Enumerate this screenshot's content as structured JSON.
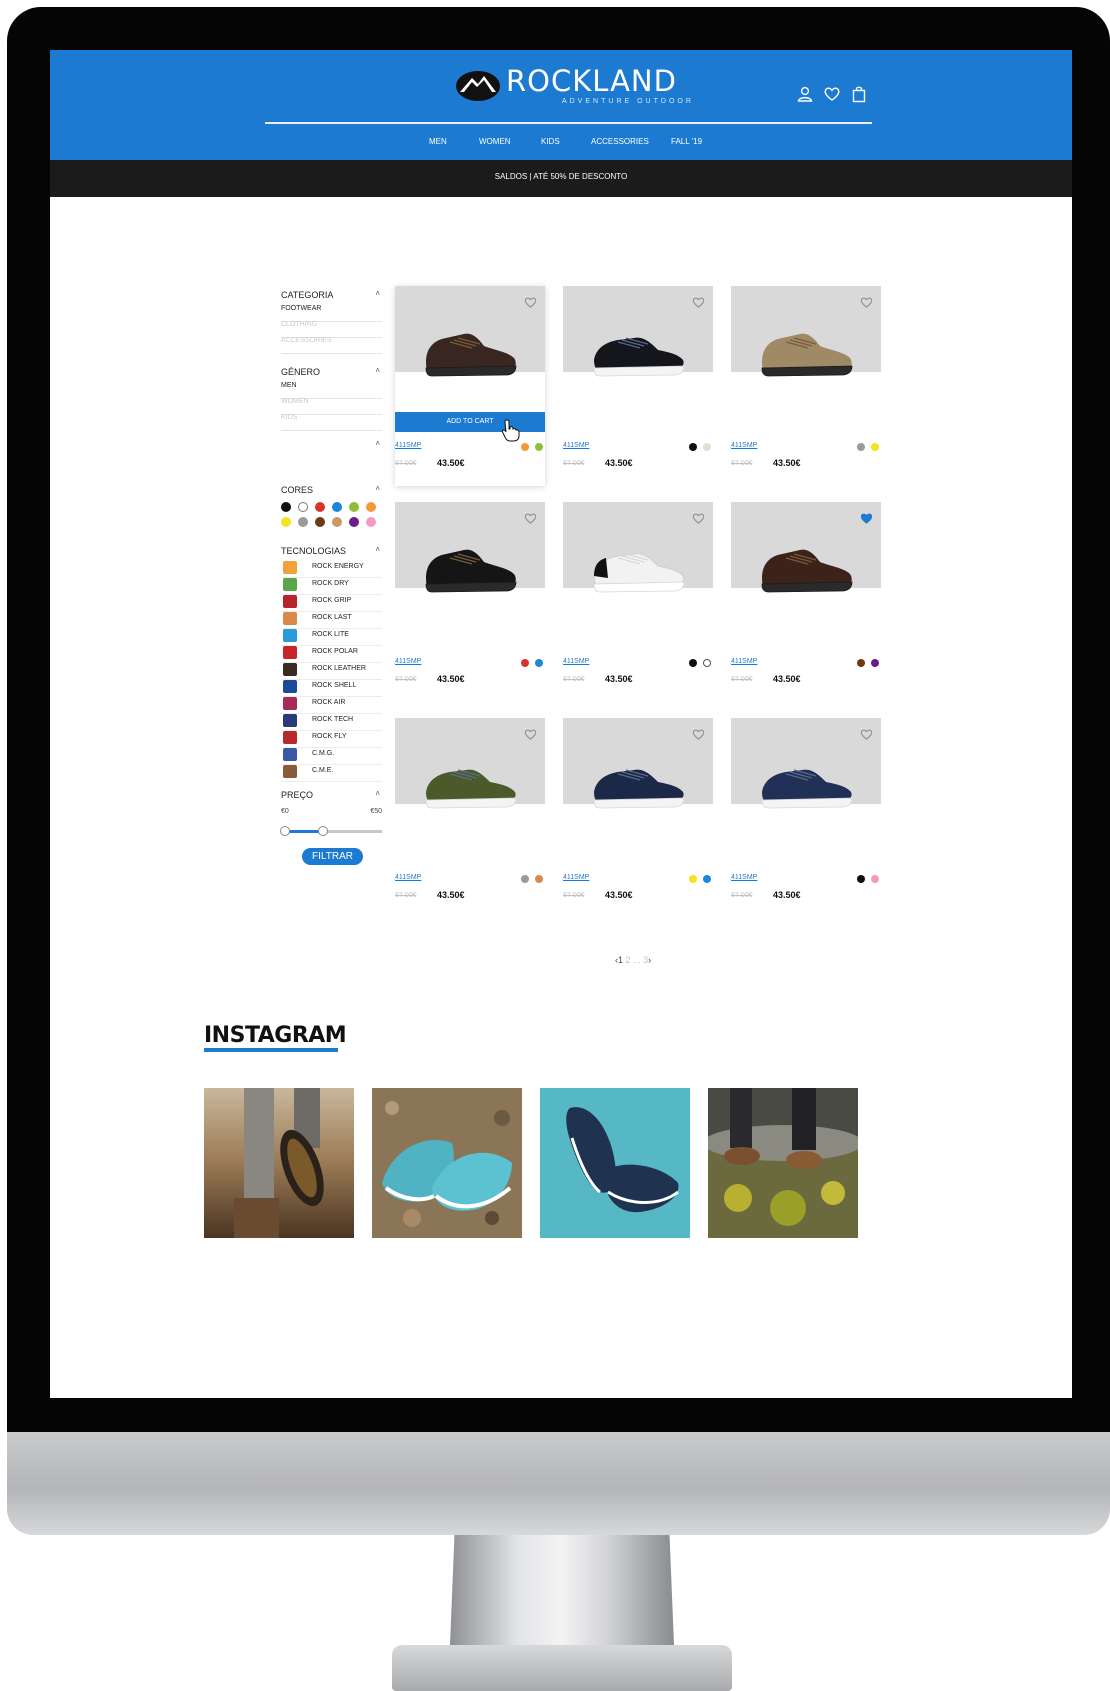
{
  "brand": {
    "name": "ROCKLAND",
    "tagline": "ADVENTURE OUTDOOR",
    "color_primary": "#1c7ad0",
    "color_dark": "#1b1b1b"
  },
  "header": {
    "icons": [
      "user-icon",
      "heart-icon",
      "shopping-bag-icon"
    ],
    "nav": [
      "MEN",
      "WOMEN",
      "KIDS",
      "ACCESSORIES",
      "FALL '19"
    ]
  },
  "promo": "SALDOS | ATÉ 50% DE DESCONTO",
  "filters": {
    "categoria": {
      "title": "CATEGORIA",
      "items": [
        "FOOTWEAR",
        "CLOTHING",
        "ACCESSORIES"
      ]
    },
    "genero": {
      "title": "GÉNERO",
      "items": [
        "MEN",
        "WOMEN",
        "KIDS"
      ]
    },
    "cores": {
      "title": "CORES",
      "swatches": [
        "#111111",
        "#ffffff",
        "#d8352a",
        "#1c86d8",
        "#8fbf3a",
        "#f29a38",
        "#f7e21c",
        "#9a9a9a",
        "#6b3a16",
        "#c79a67",
        "#6a1b8c",
        "#f49ac1"
      ]
    },
    "tecnologias": {
      "title": "TECNOLOGIAS",
      "items": [
        {
          "label": "ROCK ENERGY",
          "icon": "rock-energy-icon",
          "color": "#f2a23a"
        },
        {
          "label": "ROCK DRY",
          "icon": "rock-dry-icon",
          "color": "#5aa64a"
        },
        {
          "label": "ROCK GRIP",
          "icon": "rock-grip-icon",
          "color": "#b8242c"
        },
        {
          "label": "ROCK LAST",
          "icon": "rock-last-icon",
          "color": "#d98a4a"
        },
        {
          "label": "ROCK LITE",
          "icon": "rock-lite-icon",
          "color": "#2a9ad8"
        },
        {
          "label": "ROCK POLAR",
          "icon": "rock-polar-icon",
          "color": "#c8242c"
        },
        {
          "label": "ROCK LEATHER",
          "icon": "rock-leather-icon",
          "color": "#3a2a22"
        },
        {
          "label": "ROCK SHELL",
          "icon": "rock-shell-icon",
          "color": "#1c4a9a"
        },
        {
          "label": "ROCK AIR",
          "icon": "rock-air-icon",
          "color": "#a82a5a"
        },
        {
          "label": "ROCK TECH",
          "icon": "rock-tech-icon",
          "color": "#2a3a7a"
        },
        {
          "label": "ROCK FLY",
          "icon": "rock-fly-icon",
          "color": "#b82a2a"
        },
        {
          "label": "C.M.G.",
          "icon": "cmg-icon",
          "color": "#3a5aa8"
        },
        {
          "label": "C.M.E.",
          "icon": "cme-icon",
          "color": "#8a5a3a"
        }
      ]
    },
    "preco": {
      "title": "PREÇO",
      "min_label": "€0",
      "max_label": "€50",
      "range_fraction": [
        0.0,
        0.42
      ],
      "button": "FILTRAR"
    }
  },
  "products": [
    {
      "sku": "411SMP",
      "old_price": "87.00€",
      "price": "43.50€",
      "hover": true,
      "cart_label": "ADD TO CART",
      "favorite": false,
      "colors": [
        "#f29a38",
        "#8fbf3a"
      ],
      "shoe": "dark-brown-hiker",
      "upper": "#3a2620"
    },
    {
      "sku": "411SMP",
      "old_price": "87.00€",
      "price": "43.50€",
      "hover": false,
      "favorite": false,
      "colors": [
        "#111111",
        "#e6ddd2"
      ],
      "shoe": "black-runner",
      "upper": "#14161c"
    },
    {
      "sku": "411SMP",
      "old_price": "87.00€",
      "price": "43.50€",
      "hover": false,
      "favorite": false,
      "colors": [
        "#9a9a9a",
        "#f7e21c"
      ],
      "shoe": "tan-hiker",
      "upper": "#a08a66"
    },
    {
      "sku": "411SMP",
      "old_price": "87.00€",
      "price": "43.50€",
      "hover": false,
      "favorite": false,
      "colors": [
        "#d8352a",
        "#1c86d8"
      ],
      "shoe": "black-hiker",
      "upper": "#151515"
    },
    {
      "sku": "411SMP",
      "old_price": "87.00€",
      "price": "43.50€",
      "hover": false,
      "favorite": false,
      "colors": [
        "#111111",
        "#ffffff"
      ],
      "shoe": "white-sneaker",
      "upper": "#f2f2f2"
    },
    {
      "sku": "411SMP",
      "old_price": "87.00€",
      "price": "43.50€",
      "hover": false,
      "favorite": true,
      "colors": [
        "#6b3a16",
        "#6a1b8c"
      ],
      "shoe": "brown-hiker",
      "upper": "#3c2218"
    },
    {
      "sku": "411SMP",
      "old_price": "87.00€",
      "price": "43.50€",
      "hover": false,
      "favorite": false,
      "colors": [
        "#9a9a9a",
        "#d98a4a"
      ],
      "shoe": "olive-sneaker",
      "upper": "#4a5a2a"
    },
    {
      "sku": "411SMP",
      "old_price": "87.00€",
      "price": "43.50€",
      "hover": false,
      "favorite": false,
      "colors": [
        "#f7e21c",
        "#1c86d8"
      ],
      "shoe": "navy-runner",
      "upper": "#1c2848"
    },
    {
      "sku": "411SMP",
      "old_price": "87.00€",
      "price": "43.50€",
      "hover": false,
      "favorite": false,
      "colors": [
        "#111111",
        "#f49ac1"
      ],
      "shoe": "navy-runner-2",
      "upper": "#203056"
    }
  ],
  "pagination": {
    "prev": "‹",
    "current": "1",
    "pages": [
      "2",
      "...",
      "3"
    ],
    "next": "›"
  },
  "instagram": {
    "title": "INSTAGRAM",
    "photos": [
      "hiker-boot-sole-photo",
      "teal-sneakers-on-gravel-photo",
      "teal-sneakers-on-blue-photo",
      "boots-on-rock-photo"
    ]
  }
}
